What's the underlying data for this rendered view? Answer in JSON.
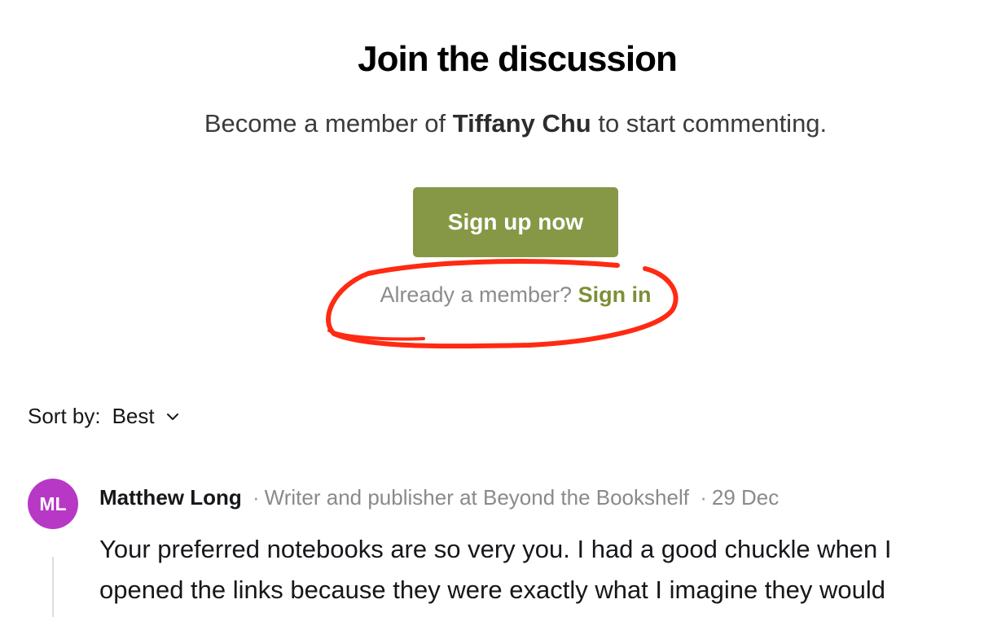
{
  "cta": {
    "title": "Join the discussion",
    "subtitle_prefix": "Become a member of ",
    "publication": "Tiffany Chu",
    "subtitle_suffix": " to start commenting.",
    "signup_label": "Sign up now",
    "signin_prompt": "Already a member?",
    "signin_label": "Sign in"
  },
  "sort": {
    "label": "Sort by:",
    "value": "Best",
    "icon": "chevron-down-icon"
  },
  "comments": [
    {
      "initials": "ML",
      "author": "Matthew Long",
      "separator": "·",
      "bio": "Writer and publisher at Beyond the Bookshelf",
      "date": "29 Dec",
      "text": "Your preferred notebooks are so very you. I had a good chuckle when I opened the links because they were exactly what I imagine they would"
    }
  ],
  "colors": {
    "accent": "#869845",
    "link": "#7d8f36",
    "avatar": "#b838c6",
    "annotation": "#ff2a12"
  }
}
